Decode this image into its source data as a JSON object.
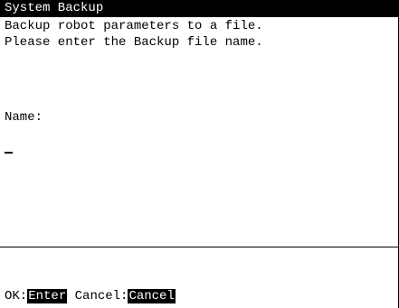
{
  "window": {
    "title": "System Backup"
  },
  "message": {
    "line1": "Backup robot parameters to a file.",
    "line2": "Please enter the Backup file name."
  },
  "form": {
    "name_label": "Name:",
    "name_value": ""
  },
  "footer": {
    "ok_prefix": "OK:",
    "ok_key": "Enter",
    "cancel_prefix": "Cancel:",
    "cancel_key": "Cancel"
  },
  "colors": {
    "background": "#ffffff",
    "foreground": "#000000",
    "highlight": "#000000"
  }
}
